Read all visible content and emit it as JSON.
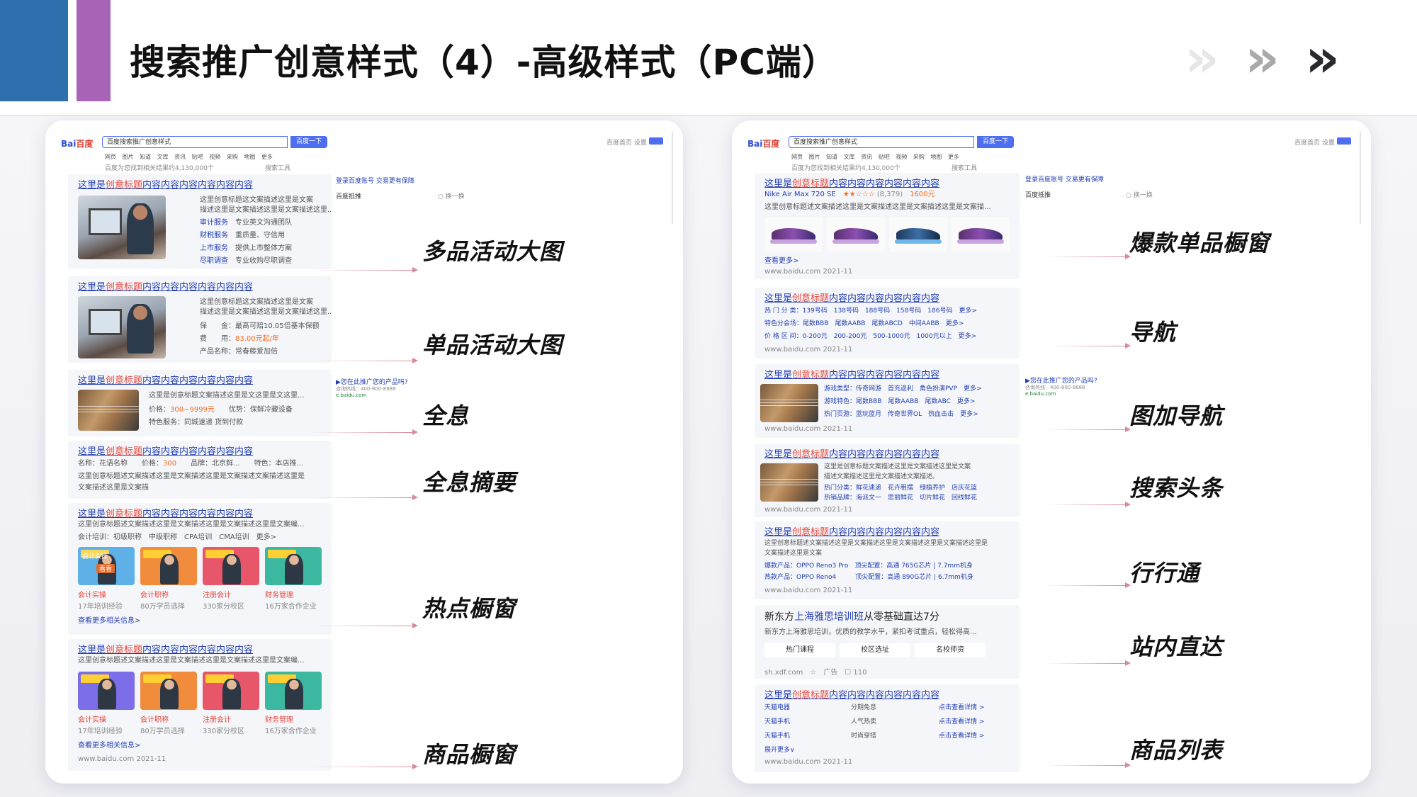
{
  "page": {
    "title": "搜索推广创意样式（4）-高级样式（PC端）",
    "chevrons": "»"
  },
  "colors": {
    "accent_blue": "#2f6fad",
    "accent_purple": "#a865b8",
    "baidu_blue": "#4e6ef2",
    "title_link": "#2440b3",
    "highlight_red": "#e5473b"
  },
  "serp": {
    "logo_bai": "Bai",
    "logo_du": "百度",
    "query_left": "百度搜索推广创意样式",
    "query_right": "百度搜索推广创意样式",
    "button": "百度一下",
    "nav": "网页 图片 知道 文库 资讯 贴吧 视频 采购 地图 更多",
    "result_count_left": "百度为您找到相关结果约4,130,000个",
    "result_count_right": "百度为您找到相关结果约4,130,000个",
    "tools": "搜索工具",
    "top_links": "百度首页 设置",
    "trust": "登录百度账号 交易更有保障",
    "scope": "百度抵推",
    "side_ad": "▶您在此推广您的产品吗?",
    "side_phone": "咨询热线：400-800-8888",
    "side_url": "e.baidu.com"
  },
  "left": {
    "label_multi": "多品活动大图",
    "label_single": "单品活动大图",
    "label_full": "全息",
    "label_full_summary": "全息摘要",
    "label_hot": "热点橱窗",
    "label_goods": "商品橱窗",
    "t_pre": "这里是",
    "t_hl": "创意标题",
    "t_post": "内容内容内容内容内容内容",
    "c1_desc1": "这里创意标题这文案描述这里是文案",
    "c1_desc2": "描述这里是文案描述这里是文案描述这里...",
    "c1_r1k": "审计服务",
    "c1_r1v": "专业英文沟通团队",
    "c1_r2k": "财税服务",
    "c1_r2v": "重质量、守信用",
    "c1_r3k": "上市服务",
    "c1_r3v": "提供上市整体方案",
    "c1_r4k": "尽职调查",
    "c1_r4v": "专业收购尽职调查",
    "c2_desc1": "这里创意标题这文案描述这里是文案",
    "c2_desc2": "描述这里是文案描述这里是文案描述这里...",
    "c2_r1": "保　　金：最高可赔10.05倍基本保额",
    "c2_r2k": "费　　用：",
    "c2_r2v": "83.00元起/年",
    "c2_r3": "产品名称：常春藤爱加倍",
    "c3_desc": "这里是创意标题文案描述这里是文这里是文这里...",
    "c3_r1k": "价格：",
    "c3_r1v": "300~9999元",
    "c3_r1x": "优势：保鲜冷藏设备",
    "c3_r2": "特色服务：同城速递 货到付款",
    "c4_r1": "名称：花语名称　　价格：",
    "c4_r1v": "300",
    "c4_r1x": "　　品牌：北京鲜...　　特色：本店推...",
    "c4_desc1": "这里创意标题述文案描述这里是文案描述这里是文案描述文案描述这里是",
    "c4_desc2": "文案描述这里是文案描",
    "c5_desc": "这里创意标题述文案描述这里是文案描述这里是文案描述这里是文案编...",
    "c5_nav": "会计培训：初级职称　中级职称　CPA培训　CMA培训　更多>",
    "c5_thumb_tag": "会计实操",
    "c5_thumb_btn": "看看",
    "items": [
      {
        "name": "会计实操",
        "sub": "17年培训经验"
      },
      {
        "name": "会计职称",
        "sub": "80万学员选择"
      },
      {
        "name": "注册会计",
        "sub": "330家分校区"
      },
      {
        "name": "财务管理",
        "sub": "16万家合作企业"
      }
    ],
    "c5_more": "查看更多相关信息>",
    "c6_desc": "这里创意标题述文案描述这里是文案描述这里是文案描述这里是文案编...",
    "c6_more": "查看更多相关信息>",
    "c6_url": "www.baidu.com 2021-11"
  },
  "right": {
    "label_hot_item": "爆款单品橱窗",
    "label_nav": "导航",
    "label_img_nav": "图加导航",
    "label_headline": "搜索头条",
    "label_industry": "行行通",
    "label_direct": "站内直达",
    "label_goods_list": "商品列表",
    "t_pre": "这里是",
    "t_hl": "创意标题",
    "t_post": "内容内容内容内容内容内容",
    "r1_prod": "Nike Air Max 720 SE",
    "r1_stars": "★★☆☆☆",
    "r1_count": "(8,379)",
    "r1_price": "1600元",
    "r1_desc": "这里创意标题述文案描述这里是文案描述这里是文案描述这里是文案描...",
    "r1_more": "查看更多>",
    "url": "www.baidu.com 2021-11",
    "r2_n1": "热 门 分 类：139号码　138号码　188号码　158号码　186号码　更多>",
    "r2_n2": "特色分会场：尾数BBB　尾数AABB　尾数ABCD　中间AABB　更多>",
    "r2_n3": "价 格 区 间：0-200元　200-200元　500-1000元　1000元以上　更多>",
    "r3_n1": "游戏类型：传奇网游　首充返利　角色扮演PVP　更多>",
    "r3_n2": "游戏特色：尾数BBB　尾数AABB　尾数ABC　更多>",
    "r3_n3": "热门页游：蓝玩蓝月　传奇世界OL　热血击击　更多>",
    "r4_desc1": "这里是创意标题文案描述这里是文案描述这里是文案",
    "r4_desc2": "描述文案描述这里是文案描述文案描述。",
    "r4_n1": "热门分类：鲜花速递　花卉租摆　绿植养护　店庆花篮",
    "r4_n2": "热销品牌：海派文一　思丽鲜花　切片鲜花　回线鲜花",
    "r5_desc1": "这里创意标题述文案描述这里是文案描述这里是文案描述这里是文案描述这里是",
    "r5_desc2": "文案描述这里是文案",
    "r5_p1": "爆款产品：OPPO Reno3 Pro　顶尖配置：高通 765G芯片 | 7.7mm机身",
    "r5_p2": "热款产品：OPPO Reno4　　　顶尖配置：高通 890G芯片 | 6.7mm机身",
    "r6_title_a": "新东方",
    "r6_title_b": "上海雅思培训班",
    "r6_title_c": "从零基础直达7分",
    "r6_desc": "新东方上海雅思培训，优质的教学水平，紧扣考试重点，轻松得高...",
    "r6_tabs": [
      "热门课程",
      "校区选址",
      "名校师资"
    ],
    "r6_url": "sh.xdf.com　☆　广告　☐ 110",
    "r7_rows": [
      {
        "a": "天猫电器",
        "b": "分期免息",
        "c": "点击查看详情 >"
      },
      {
        "a": "天猫手机",
        "b": "人气热卖",
        "c": "点击查看详情 >"
      },
      {
        "a": "天猫手机",
        "b": "时尚穿搭",
        "c": "点击查看详情 >"
      }
    ],
    "r7_more": "展开更多∨"
  }
}
